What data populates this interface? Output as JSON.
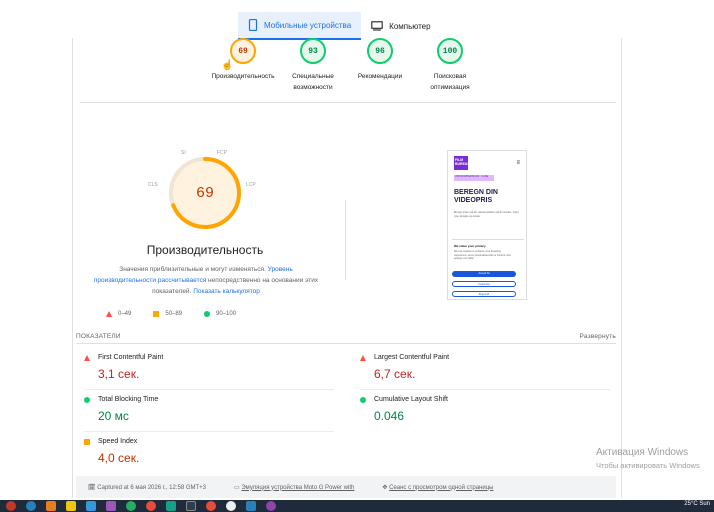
{
  "tabs": [
    {
      "label": "Мобильные устройства",
      "active": true,
      "icon": "phone-icon"
    },
    {
      "label": "Компьютер",
      "active": false,
      "icon": "desktop-icon"
    }
  ],
  "categories": [
    {
      "score": "69",
      "label1": "Производительность",
      "label2": "",
      "status": "orange"
    },
    {
      "score": "93",
      "label1": "Специальные",
      "label2": "возможности",
      "status": "green"
    },
    {
      "score": "96",
      "label1": "Рекомендации",
      "label2": "",
      "status": "green"
    },
    {
      "score": "100",
      "label1": "Поисковая",
      "label2": "оптимизация",
      "status": "green"
    }
  ],
  "performance": {
    "score": "69",
    "score_fraction": 0.69,
    "title": "Производительность",
    "metric_tags": {
      "si": "SI",
      "fcp": "FCP",
      "lcp": "LCP",
      "cls": "CLS"
    },
    "desc_before": "Значения приблизительные и могут изменяться. ",
    "desc_link1": "Уровень производительности рассчитывается",
    "desc_middle": " непосредственно на основании этих показателей. ",
    "desc_link2": "Показать калькулятор"
  },
  "legend": [
    {
      "shape": "triangle",
      "label": "0–49"
    },
    {
      "shape": "square",
      "label": "50–89"
    },
    {
      "shape": "circle",
      "label": "90–100"
    }
  ],
  "preview": {
    "brand": "FILM BUREAU",
    "highlight": "VIRKSOMHEDSFILM · CASE",
    "headline": "BEREGN DIN VIDEOPRIS",
    "body": "Beregn prisen på din videoproduktion på få minutter. Vælg type, længde og ønsker.",
    "cookie_title": "We value your privacy",
    "cookie_body": "We use cookies to enhance your browsing experience, serve personalised ads or content, and analyse our traffic.",
    "btn_accept": "Accept All",
    "btn_customise": "Customise",
    "btn_reject": "Reject All"
  },
  "metrics_section": {
    "title": "ПОКАЗАТЕЛИ",
    "expand": "Развернуть"
  },
  "metrics": [
    {
      "name": "First Contentful Paint",
      "value": "3,1 сек.",
      "status": "red"
    },
    {
      "name": "Largest Contentful Paint",
      "value": "6,7 сек.",
      "status": "red"
    },
    {
      "name": "Total Blocking Time",
      "value": "20 мс",
      "status": "green"
    },
    {
      "name": "Cumulative Layout Shift",
      "value": "0.046",
      "status": "green"
    },
    {
      "name": "Speed Index",
      "value": "4,0 сек.",
      "status": "orange"
    }
  ],
  "footer": {
    "captured": "Captured at 6 мая 2026 г., 12:58 GMT+3",
    "emulation": "Эмуляция устройства Moto G Power with",
    "session": "Сеанс с просмотром одной страницы"
  },
  "watermark": {
    "line1": "Активация Windows",
    "line2": "Чтобы активировать Windows"
  },
  "taskbar": {
    "tray_text": "25°C  Sun"
  },
  "colors": {
    "accent": "#1a73e8",
    "pass": "#0cce6b",
    "average": "#ffa400",
    "fail": "#ff4e42"
  }
}
